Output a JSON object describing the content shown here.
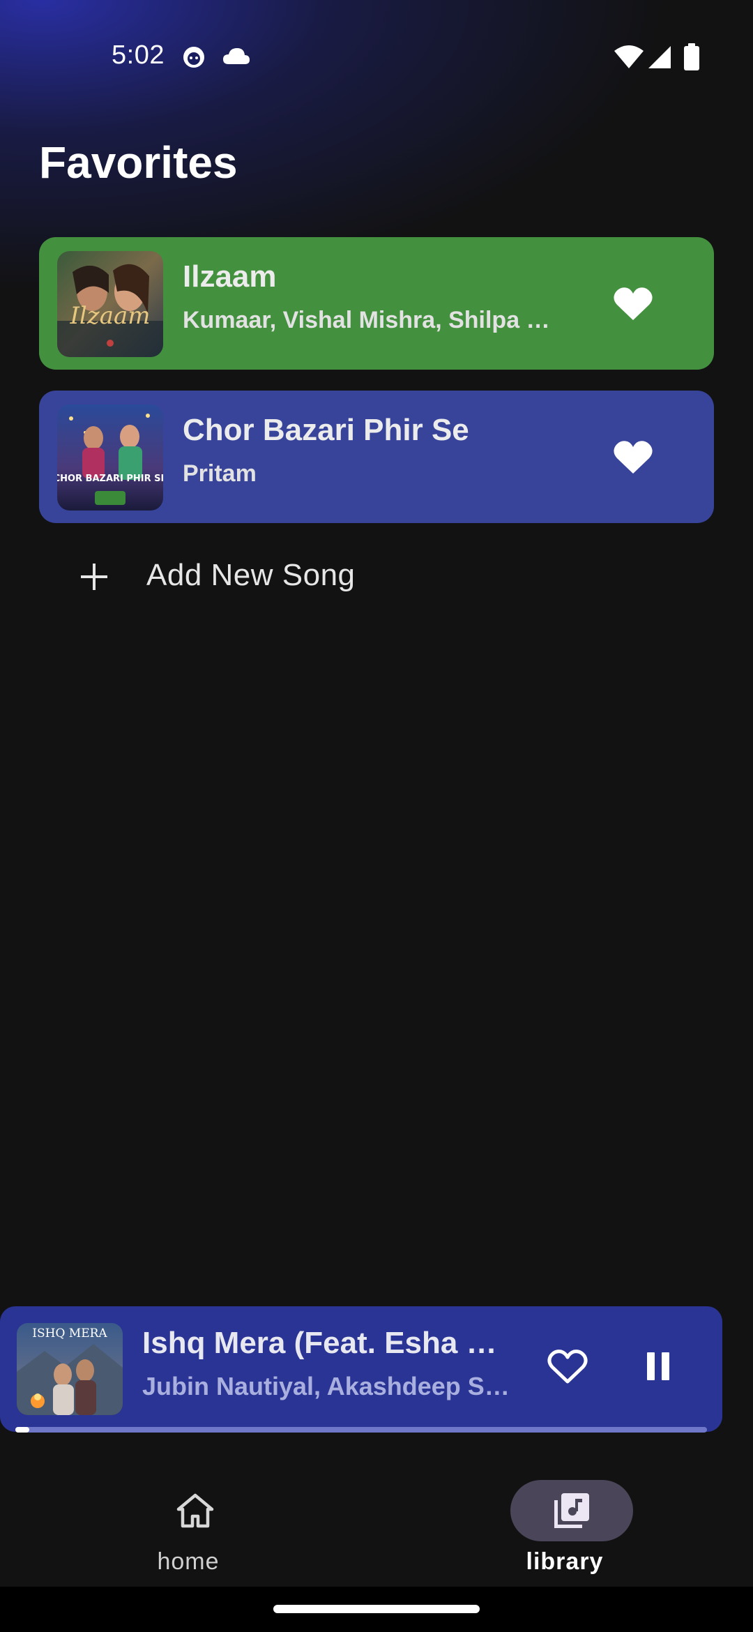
{
  "status_bar": {
    "time": "5:02",
    "left_icons": [
      "face-notification-icon",
      "cloud-icon"
    ],
    "right_icons": [
      "wifi-icon",
      "signal-icon",
      "battery-icon"
    ]
  },
  "page": {
    "title": "Favorites"
  },
  "favorites": [
    {
      "title": "Ilzaam",
      "artist": "Kumaar, Vishal Mishra, Shilpa Rao",
      "card_color": "#43903f",
      "favorited": true,
      "art_icon": "album-art-ilzaam",
      "art_text": "Ilzaam"
    },
    {
      "title": "Chor Bazari Phir Se",
      "artist": "Pritam",
      "card_color": "#37449a",
      "favorited": true,
      "art_icon": "album-art-chor-bazari",
      "art_text": "CHOR BAZARI PHIR SE"
    }
  ],
  "add_song": {
    "label": "Add New Song",
    "icon": "plus-icon"
  },
  "now_playing": {
    "title": "Ishq Mera (Feat. Esha Gupta)",
    "artist": "Jubin Nautiyal, Akashdeep Sengupta",
    "favorited": false,
    "state": "playing",
    "progress": 0.02,
    "art_icon": "album-art-ishq-mera",
    "art_text": "ISHQ MERA",
    "background_color": "#2a3494"
  },
  "bottom_nav": {
    "items": [
      {
        "label": "home",
        "icon": "home-icon",
        "active": false
      },
      {
        "label": "library",
        "icon": "library-music-icon",
        "active": true
      }
    ]
  }
}
